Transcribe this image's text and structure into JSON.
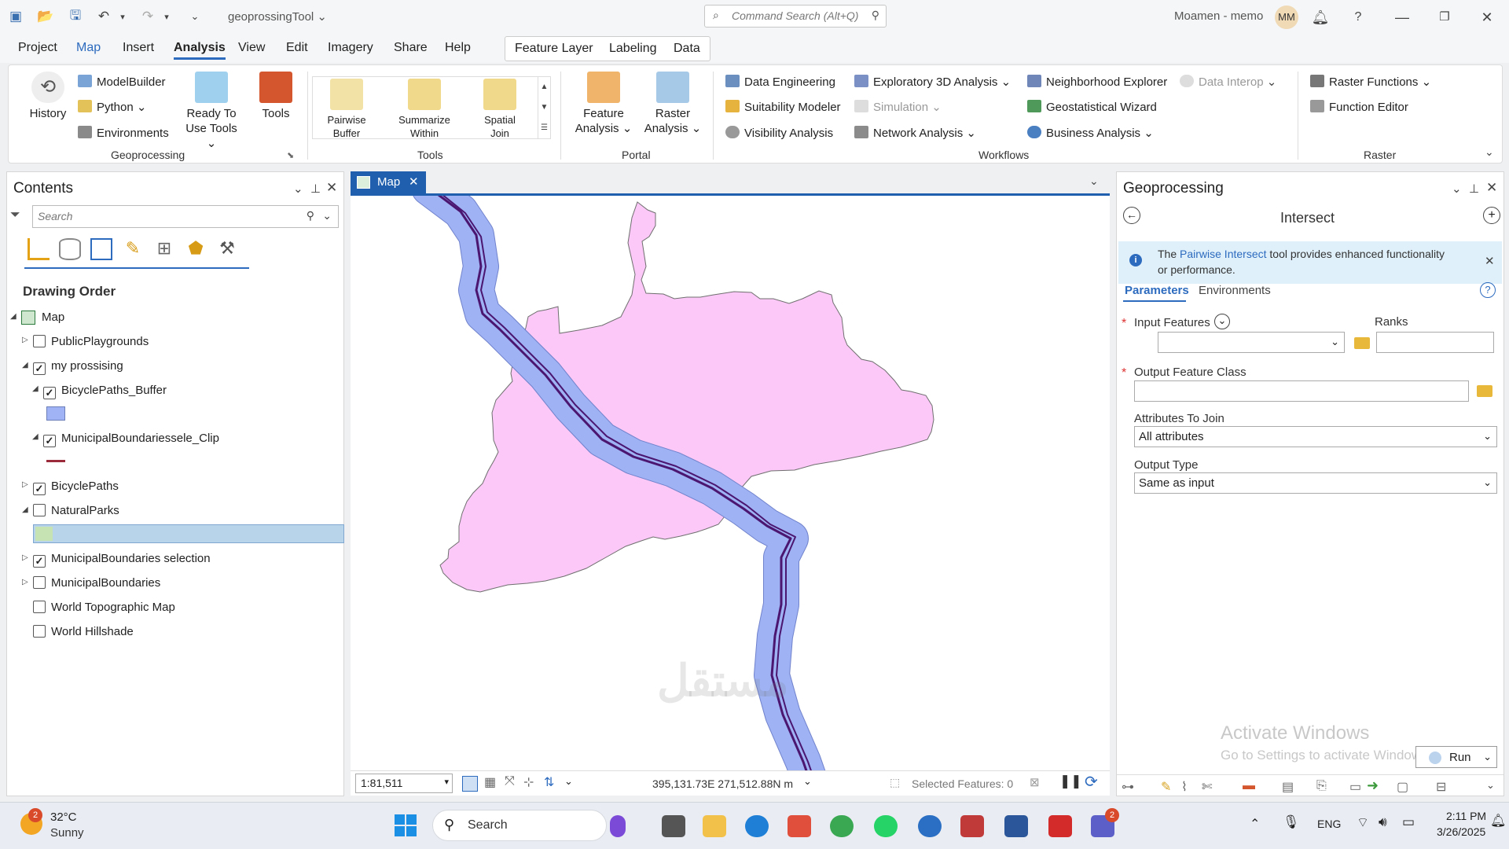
{
  "titlebar": {
    "doc_title": "geoprossingTool",
    "command_search_placeholder": "Command Search (Alt+Q)",
    "user": "Moamen - memo",
    "avatar_initials": "MM",
    "help": "?"
  },
  "menu": {
    "items": [
      "Project",
      "Map",
      "Insert",
      "Analysis",
      "View",
      "Edit",
      "Imagery",
      "Share",
      "Help"
    ],
    "context_tabs": [
      "Feature Layer",
      "Labeling",
      "Data"
    ]
  },
  "ribbon": {
    "geoprocessing": {
      "history": "History",
      "modelbuilder": "ModelBuilder",
      "python": "Python",
      "environments": "Environments",
      "ready_to_use_1": "Ready To",
      "ready_to_use_2": "Use Tools",
      "tools": "Tools",
      "group": "Geoprocessing"
    },
    "tools_gallery": {
      "pairwise_buffer_1": "Pairwise",
      "pairwise_buffer_2": "Buffer",
      "summarize_within_1": "Summarize",
      "summarize_within_2": "Within",
      "spatial_join_1": "Spatial",
      "spatial_join_2": "Join",
      "group": "Tools"
    },
    "portal": {
      "feature_analysis_1": "Feature",
      "feature_analysis_2": "Analysis",
      "raster_analysis_1": "Raster",
      "raster_analysis_2": "Analysis",
      "group": "Portal"
    },
    "workflows": {
      "data_engineering": "Data Engineering",
      "suitability_modeler": "Suitability Modeler",
      "visibility_analysis": "Visibility Analysis",
      "exploratory_3d": "Exploratory 3D Analysis",
      "simulation": "Simulation",
      "network_analysis": "Network Analysis",
      "neighborhood_explorer": "Neighborhood Explorer",
      "data_interop": "Data Interop",
      "geostatistical_wizard": "Geostatistical Wizard",
      "business_analysis": "Business Analysis",
      "group": "Workflows"
    },
    "raster": {
      "raster_functions": "Raster Functions",
      "function_editor": "Function Editor",
      "group": "Raster"
    }
  },
  "contents": {
    "title": "Contents",
    "search_placeholder": "Search",
    "section": "Drawing Order",
    "root": "Map",
    "layers": [
      {
        "name": "PublicPlaygrounds",
        "checked": false
      },
      {
        "name": "my prossising",
        "checked": true
      },
      {
        "name": "BicyclePaths_Buffer",
        "checked": true
      },
      {
        "name": "MunicipalBoundariessele_Clip",
        "checked": true
      },
      {
        "name": "BicyclePaths",
        "checked": true
      },
      {
        "name": "NaturalParks",
        "checked": false
      },
      {
        "name": "MunicipalBoundaries selection",
        "checked": true
      },
      {
        "name": "MunicipalBoundaries",
        "checked": false
      },
      {
        "name": "World Topographic Map",
        "checked": false
      },
      {
        "name": "World Hillshade",
        "checked": false
      }
    ]
  },
  "map": {
    "tab_label": "Map",
    "scale": "1:81,511",
    "coordinates": "395,131.73E 271,512.88N m",
    "selected_features": "Selected Features: 0",
    "colors": {
      "boundary": "#fbc8f7",
      "buffer": "#a0b4f5",
      "path": "#4b1670"
    }
  },
  "geoprocessing": {
    "title": "Geoprocessing",
    "tool_name": "Intersect",
    "info_prefix": "The ",
    "info_link": "Pairwise Intersect",
    "info_suffix": " tool provides enhanced functionality",
    "info_line2": "or performance.",
    "tabs": [
      "Parameters",
      "Environments"
    ],
    "input_features_label": "Input Features",
    "ranks_label": "Ranks",
    "output_feature_class_label": "Output Feature Class",
    "attributes_to_join_label": "Attributes To Join",
    "attributes_to_join_value": "All attributes",
    "output_type_label": "Output Type",
    "output_type_value": "Same as input",
    "watermark_title": "Activate Windows",
    "watermark_sub": "Go to Settings to activate Windows.",
    "run_label": "Run"
  },
  "taskbar": {
    "weather_temp": "32°C",
    "weather_desc": "Sunny",
    "weather_badge": "2",
    "search_label": "Search",
    "language": "ENG",
    "time": "2:11 PM",
    "date": "3/26/2025",
    "teams_badge": "2"
  }
}
